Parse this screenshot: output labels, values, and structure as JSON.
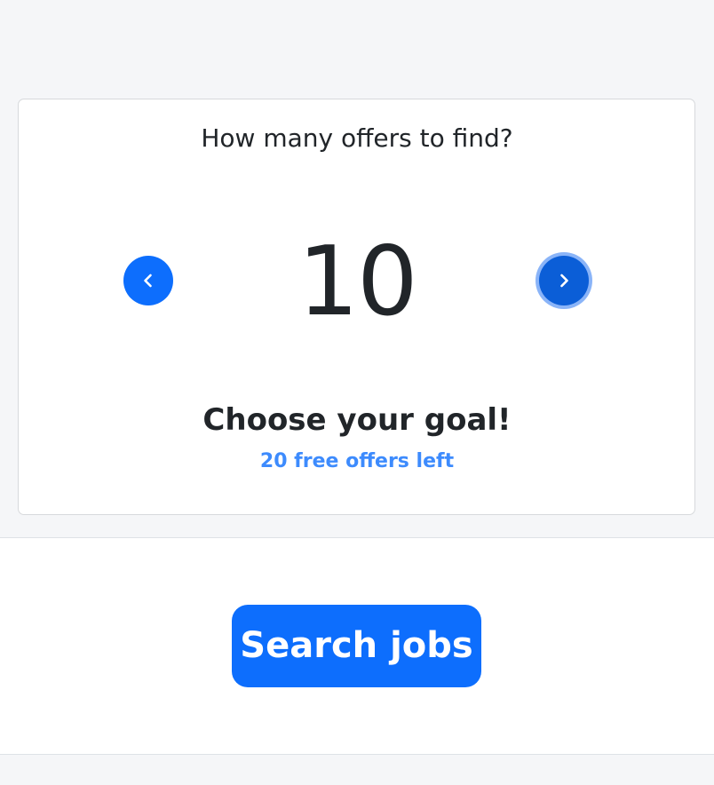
{
  "goal_picker": {
    "question": "How many offers to find?",
    "value": "10",
    "title": "Choose your goal!",
    "free_offers_text": "20 free offers left",
    "prev_icon": "chevron-left-icon",
    "next_icon": "chevron-right-icon"
  },
  "actions": {
    "search_label": "Search jobs"
  },
  "colors": {
    "primary": "#0d6efd",
    "primary_active": "#0b5ed7",
    "focus_ring": "#8ab4f8",
    "link": "#3d8bfd",
    "text": "#212529",
    "page_bg": "#f5f6f8",
    "card_bg": "#ffffff"
  }
}
